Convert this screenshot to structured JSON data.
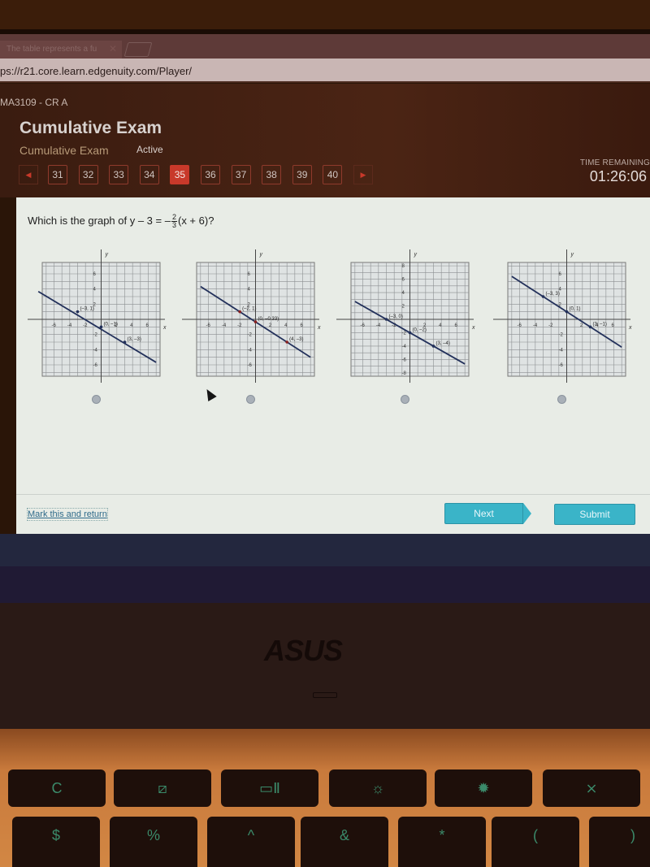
{
  "browser": {
    "tab_title": "The table represents a fu",
    "url": "ps://r21.core.learn.edgenuity.com/Player/"
  },
  "app": {
    "course_code": "MA3109 - CR A",
    "title": "Cumulative Exam",
    "subtitle": "Cumulative Exam",
    "status": "Active",
    "question_numbers": [
      "31",
      "32",
      "33",
      "34",
      "35",
      "36",
      "37",
      "38",
      "39",
      "40"
    ],
    "current_question": "35",
    "prev_icon": "◀",
    "next_icon": "▶",
    "time_label": "TIME REMAINING",
    "time_value": "01:26:06"
  },
  "question": {
    "prefix": "Which is the graph of y – 3 = –",
    "frac_num": "2",
    "frac_den": "3",
    "suffix": "(x + 6)?"
  },
  "options": [
    {
      "line_p1": [
        -8,
        3.67
      ],
      "line_p2": [
        7,
        -5.67
      ],
      "points": [
        [
          -3,
          1
        ],
        [
          0,
          -1
        ],
        [
          3,
          -3
        ]
      ],
      "labels": [
        "(–3, 1)",
        "(0, –1)",
        "(3, –3)"
      ],
      "ymin": -7,
      "ymax": 7,
      "yticks": [
        6,
        4,
        2,
        -2,
        -4,
        -6
      ],
      "xticks": [
        -6,
        -4,
        -2,
        2,
        4,
        6
      ]
    },
    {
      "line_p1": [
        -7,
        4.33
      ],
      "line_p2": [
        7,
        -5
      ],
      "points": [
        [
          -2,
          1
        ],
        [
          0,
          -0.33
        ],
        [
          4,
          -3
        ]
      ],
      "labels": [
        "(–2, 1)",
        "(0, –0.33)",
        "(4, –3)"
      ],
      "ymin": -7,
      "ymax": 7,
      "yticks": [
        6,
        4,
        2,
        -2,
        -4,
        -6
      ],
      "xticks": [
        -6,
        -4,
        -2,
        2,
        4,
        6
      ]
    },
    {
      "line_p1": [
        -7,
        2.67
      ],
      "line_p2": [
        7,
        -6.67
      ],
      "points": [
        [
          -3,
          0
        ],
        [
          0,
          -2
        ],
        [
          3,
          -4
        ]
      ],
      "labels": [
        "(–3, 0)",
        "(0, –2)",
        "(3, –4)"
      ],
      "ymin": -8,
      "ymax": 8,
      "yticks": [
        8,
        6,
        4,
        2,
        -2,
        -4,
        -6,
        -8
      ],
      "xticks": [
        -6,
        -4,
        -2,
        2,
        4,
        6
      ]
    },
    {
      "line_p1": [
        -7,
        5.67
      ],
      "line_p2": [
        7,
        -3.67
      ],
      "points": [
        [
          -3,
          3
        ],
        [
          0,
          1
        ],
        [
          3,
          -1
        ]
      ],
      "labels": [
        "(–3, 3)",
        "(0, 1)",
        "(3, –1)"
      ],
      "ymin": -7,
      "ymax": 7,
      "yticks": [
        6,
        4,
        2,
        -2,
        -4,
        -6
      ],
      "xticks": [
        -6,
        -4,
        -2,
        2,
        4,
        6
      ]
    }
  ],
  "axis_labels": {
    "x": "x",
    "y": "y"
  },
  "footer": {
    "mark_label": "Mark this and return",
    "next_label": "Next",
    "submit_label": "Submit"
  },
  "hardware": {
    "brand": "ASUS",
    "keys_row1": [
      "C",
      "⧄",
      "▭Ⅱ",
      "☼",
      "✹",
      "⨯"
    ],
    "keys_row2": [
      "$",
      "%",
      "^",
      "&",
      "*",
      "(",
      ")"
    ]
  }
}
